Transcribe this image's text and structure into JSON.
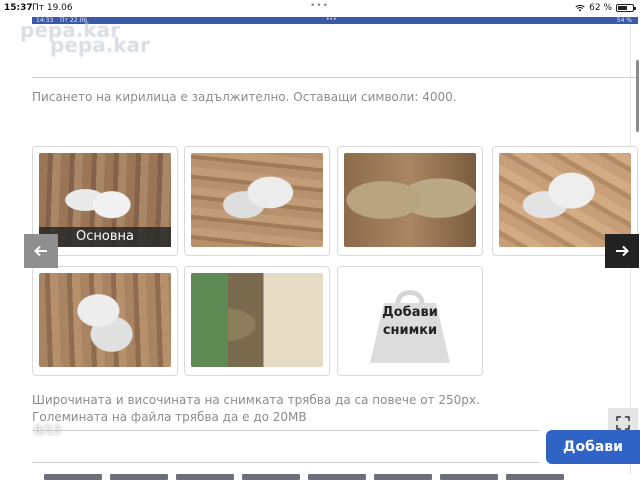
{
  "status_bar": {
    "time": "15:37",
    "date": "Пт 19.06",
    "battery": "62 %",
    "battery_level": 0.62
  },
  "inner_status": {
    "time": "14:33",
    "date": "Пт 22.06",
    "battery": "54 %"
  },
  "watermark": "pepa.kar",
  "form": {
    "hint": "Писането на кирилица е задължително. Оставащи символи: 4000.",
    "main_photo_label": "Основна",
    "add_photos_line1": "Добави",
    "add_photos_line2": "снимки",
    "note1": "Широчината и височината на снимката трябва да са повече от 250px.",
    "note2": "Големината на файла трябва да е до 20MB",
    "add_button": "Добави"
  },
  "gallery": {
    "counter": "8/13",
    "prev_icon": "arrow-left-icon",
    "next_icon": "arrow-right-icon",
    "fullscreen_icon": "fullscreen-icon"
  },
  "colors": {
    "accent": "#2f63c5",
    "nav_dark": "#222222",
    "nav_light": "#8f8f8f"
  }
}
